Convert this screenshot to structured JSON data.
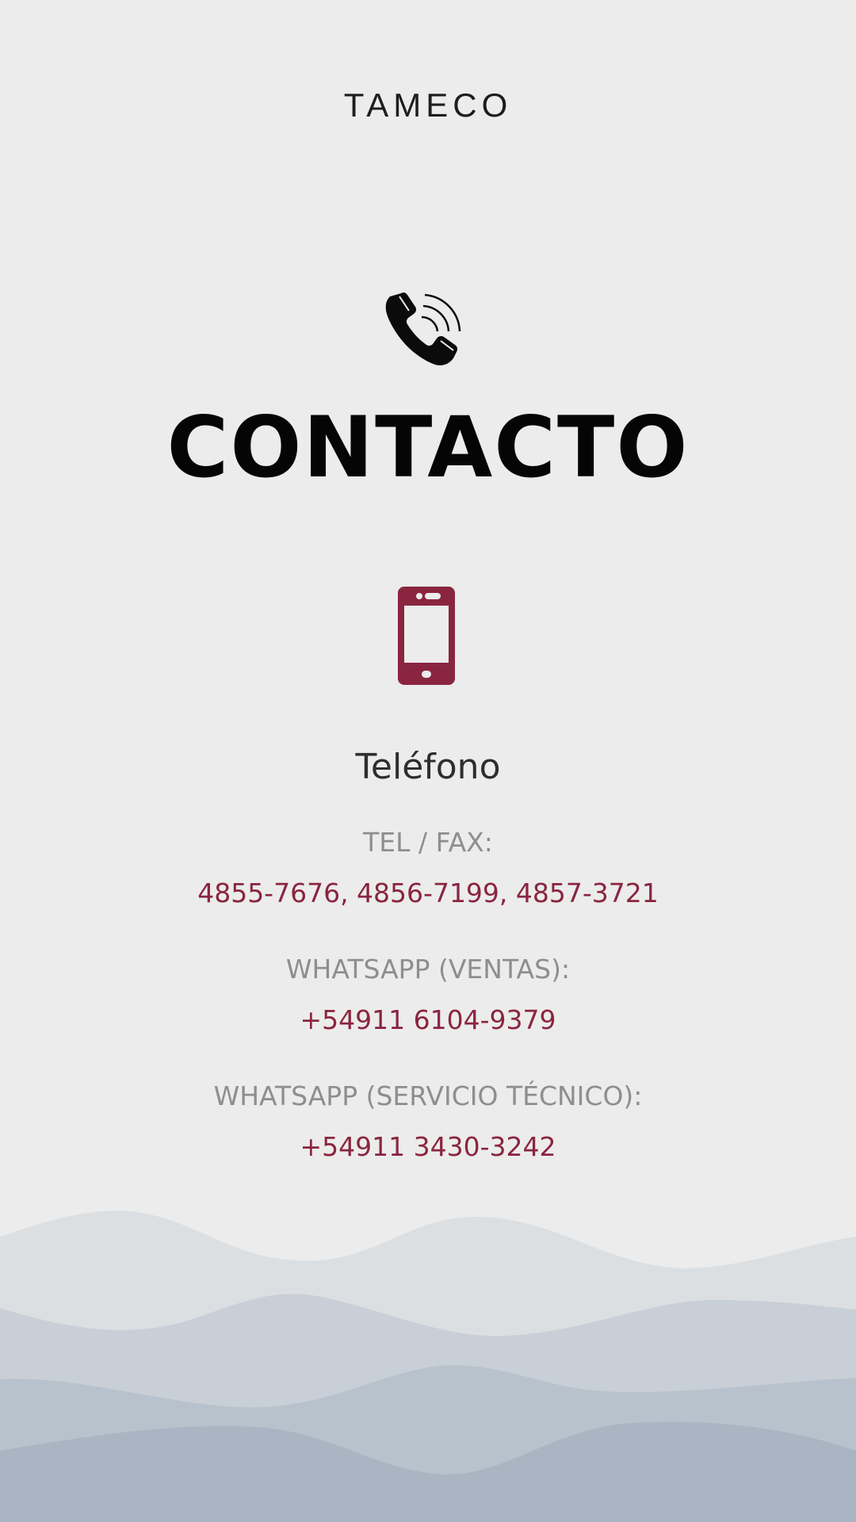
{
  "brand": {
    "logo_text": "TAMECO"
  },
  "header": {
    "title": "CONTACTO"
  },
  "phone_section": {
    "heading": "Teléfono",
    "entries": [
      {
        "label": "TEL / FAX:",
        "value": "4855-7676, 4856-7199, 4857-3721"
      },
      {
        "label": "WHATSAPP (VENTAS):",
        "value": "+54911 6104-9379"
      },
      {
        "label": "WHATSAPP (SERVICIO TÉCNICO):",
        "value": "+54911 3430-3242"
      }
    ]
  },
  "icons": {
    "call": "phone-ringing-icon",
    "mobile": "mobile-phone-icon"
  },
  "colors": {
    "background": "#ececec",
    "accent": "#8a2540",
    "label": "#8e8e8e",
    "title": "#050505",
    "wave_1": "#dcdfe2",
    "wave_2": "#c9cfd6",
    "wave_3": "#b8c2cc",
    "wave_4": "#a9b5c2"
  }
}
